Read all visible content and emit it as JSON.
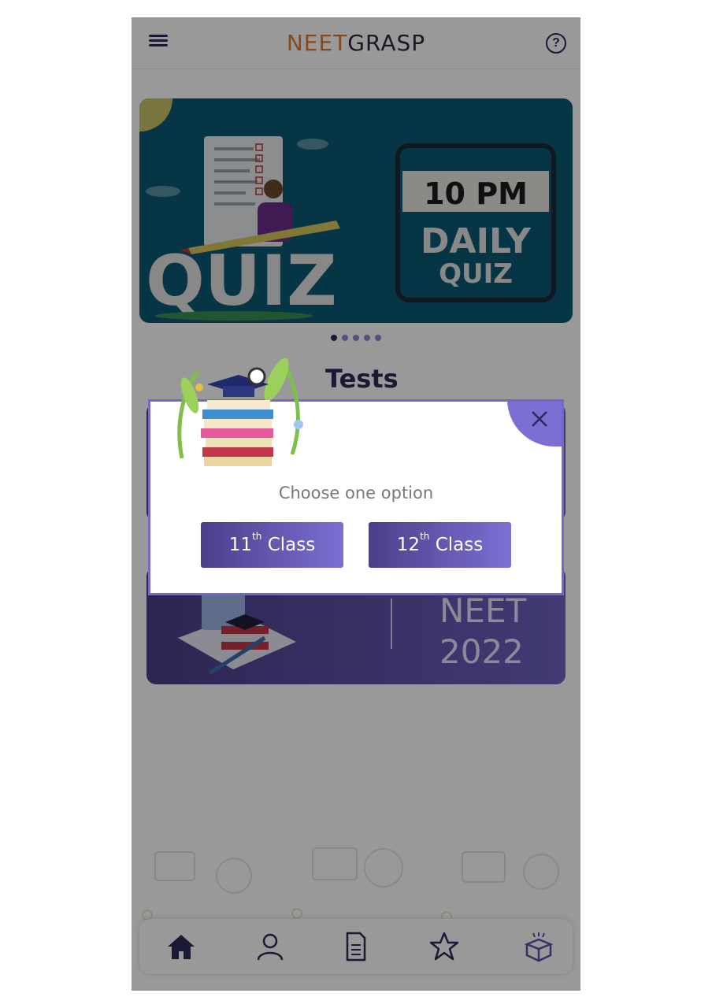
{
  "header": {
    "logo_part1": "NEET",
    "logo_part2": "GRASP",
    "menu_icon": "hamburger-menu-icon",
    "help_icon": "question-circle-icon",
    "help_symbol": "?"
  },
  "banner": {
    "quiz_word": "QUIZ",
    "time_label": "10 PM",
    "daily_label": "DAILY",
    "quiz_label": "QUIZ",
    "slide_count": 5,
    "active_slide": 1
  },
  "tests": {
    "title": "Tests",
    "card_b_title_line1": "NEET",
    "card_b_title_line2": "2022"
  },
  "modal": {
    "prompt": "Choose one option",
    "option_11_number": "11",
    "option_11_suffix": "th",
    "option_11_word": "Class",
    "option_12_number": "12",
    "option_12_suffix": "th",
    "option_12_word": "Class",
    "close_icon": "close-x-icon"
  },
  "bottom_nav": {
    "items": [
      {
        "icon": "home-icon",
        "active": true
      },
      {
        "icon": "profile-icon",
        "active": false
      },
      {
        "icon": "test-sheet-icon",
        "active": false
      },
      {
        "icon": "star-icon",
        "active": false
      },
      {
        "icon": "open-box-icon",
        "active": false
      }
    ]
  },
  "colors": {
    "primary_dark": "#2c2a5a",
    "accent_purple": "#7b6fd3",
    "logo_orange": "#e07a2e",
    "banner_teal": "#0a5a73"
  }
}
